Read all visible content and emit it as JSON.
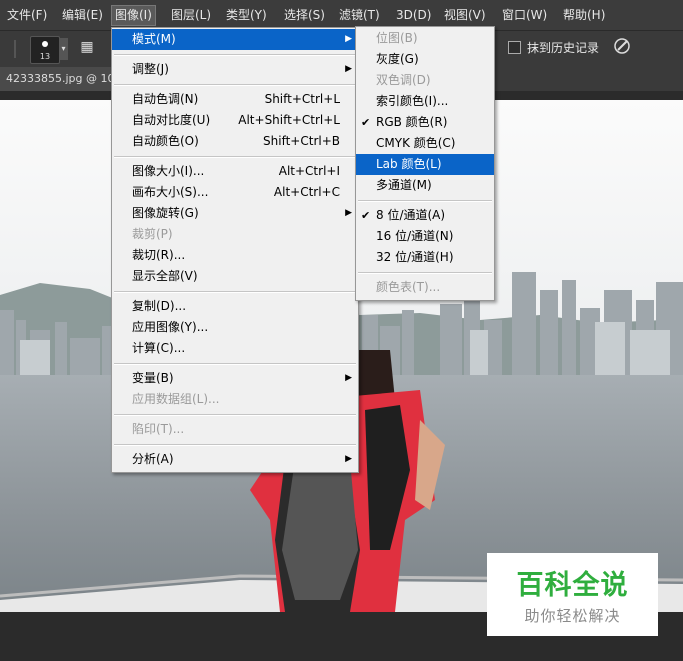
{
  "menubar": {
    "items": [
      {
        "label": "文件(F)"
      },
      {
        "label": "编辑(E)"
      },
      {
        "label": "图像(I)"
      },
      {
        "label": "图层(L)"
      },
      {
        "label": "类型(Y)"
      },
      {
        "label": "选择(S)"
      },
      {
        "label": "滤镜(T)"
      },
      {
        "label": "3D(D)"
      },
      {
        "label": "视图(V)"
      },
      {
        "label": "窗口(W)"
      },
      {
        "label": "帮助(H)"
      }
    ],
    "active": "图像(I)"
  },
  "options": {
    "brush_size": "13",
    "erase_to_history_label": "抹到历史记录",
    "erase_to_history_checked": false
  },
  "document": {
    "tab_label": "42333855.jpg @ 10"
  },
  "image_menu": {
    "items": [
      {
        "label": "模式(M)",
        "submenu": true,
        "highlighted": true
      },
      {
        "label": "调整(J)",
        "submenu": true
      },
      {
        "label": "自动色调(N)",
        "shortcut": "Shift+Ctrl+L"
      },
      {
        "label": "自动对比度(U)",
        "shortcut": "Alt+Shift+Ctrl+L"
      },
      {
        "label": "自动颜色(O)",
        "shortcut": "Shift+Ctrl+B"
      },
      {
        "label": "图像大小(I)...",
        "shortcut": "Alt+Ctrl+I"
      },
      {
        "label": "画布大小(S)...",
        "shortcut": "Alt+Ctrl+C"
      },
      {
        "label": "图像旋转(G)",
        "submenu": true
      },
      {
        "label": "裁剪(P)",
        "disabled": true
      },
      {
        "label": "裁切(R)..."
      },
      {
        "label": "显示全部(V)"
      },
      {
        "label": "复制(D)..."
      },
      {
        "label": "应用图像(Y)..."
      },
      {
        "label": "计算(C)..."
      },
      {
        "label": "变量(B)",
        "submenu": true
      },
      {
        "label": "应用数据组(L)...",
        "disabled": true
      },
      {
        "label": "陷印(T)...",
        "disabled": true
      },
      {
        "label": "分析(A)",
        "submenu": true
      }
    ]
  },
  "mode_submenu": {
    "items": [
      {
        "label": "位图(B)",
        "disabled": true
      },
      {
        "label": "灰度(G)"
      },
      {
        "label": "双色调(D)",
        "disabled": true
      },
      {
        "label": "索引颜色(I)..."
      },
      {
        "label": "RGB 颜色(R)",
        "checked": true
      },
      {
        "label": "CMYK 颜色(C)"
      },
      {
        "label": "Lab 颜色(L)",
        "highlighted": true
      },
      {
        "label": "多通道(M)"
      },
      {
        "label": "8 位/通道(A)",
        "checked": true
      },
      {
        "label": "16 位/通道(N)"
      },
      {
        "label": "32 位/通道(H)"
      },
      {
        "label": "颜色表(T)...",
        "disabled": true
      }
    ]
  },
  "watermark": {
    "title": "百科全说",
    "subtitle": "助你轻松解决"
  },
  "colors": {
    "menu_highlight": "#0a64c8",
    "watermark_green": "#2fae3e"
  }
}
